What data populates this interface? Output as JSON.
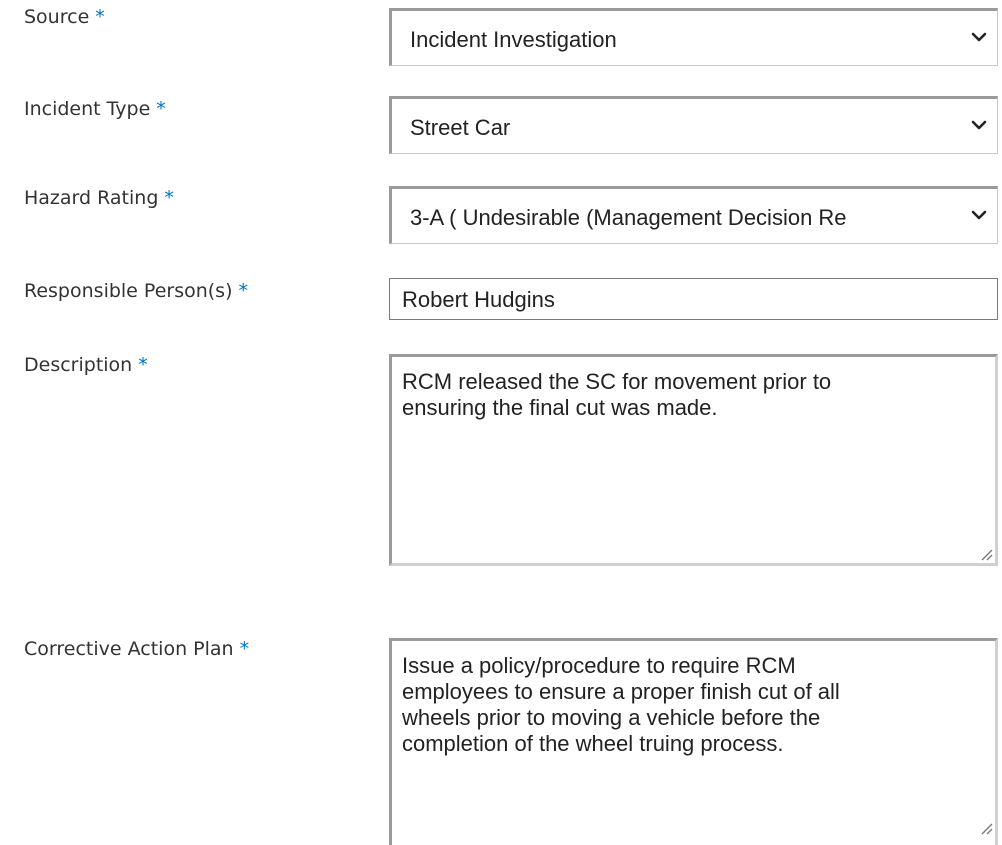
{
  "required_marker": "*",
  "fields": {
    "source": {
      "label": "Source",
      "value": "Incident Investigation"
    },
    "incident_type": {
      "label": "Incident Type",
      "value": "Street Car"
    },
    "hazard_rating": {
      "label": "Hazard Rating",
      "value": "3-A ( Undesirable (Management Decision Re"
    },
    "responsible_persons": {
      "label": "Responsible Person(s)",
      "value": "Robert Hudgins"
    },
    "description": {
      "label": "Description",
      "value": "RCM released the SC for movement prior to\nensuring the final cut was made."
    },
    "corrective_action_plan": {
      "label": "Corrective Action Plan",
      "value": "Issue a policy/procedure to require RCM\nemployees to ensure a proper finish cut of all\nwheels prior to moving a vehicle before the\ncompletion of the wheel truing process."
    }
  },
  "icons": {
    "select_arrow": "chevron-down-icon",
    "resize_handle": "resize-grip-icon"
  },
  "colors": {
    "required_marker": "#0072c6",
    "label_text": "#333333",
    "field_border": "#9a9a9a"
  }
}
